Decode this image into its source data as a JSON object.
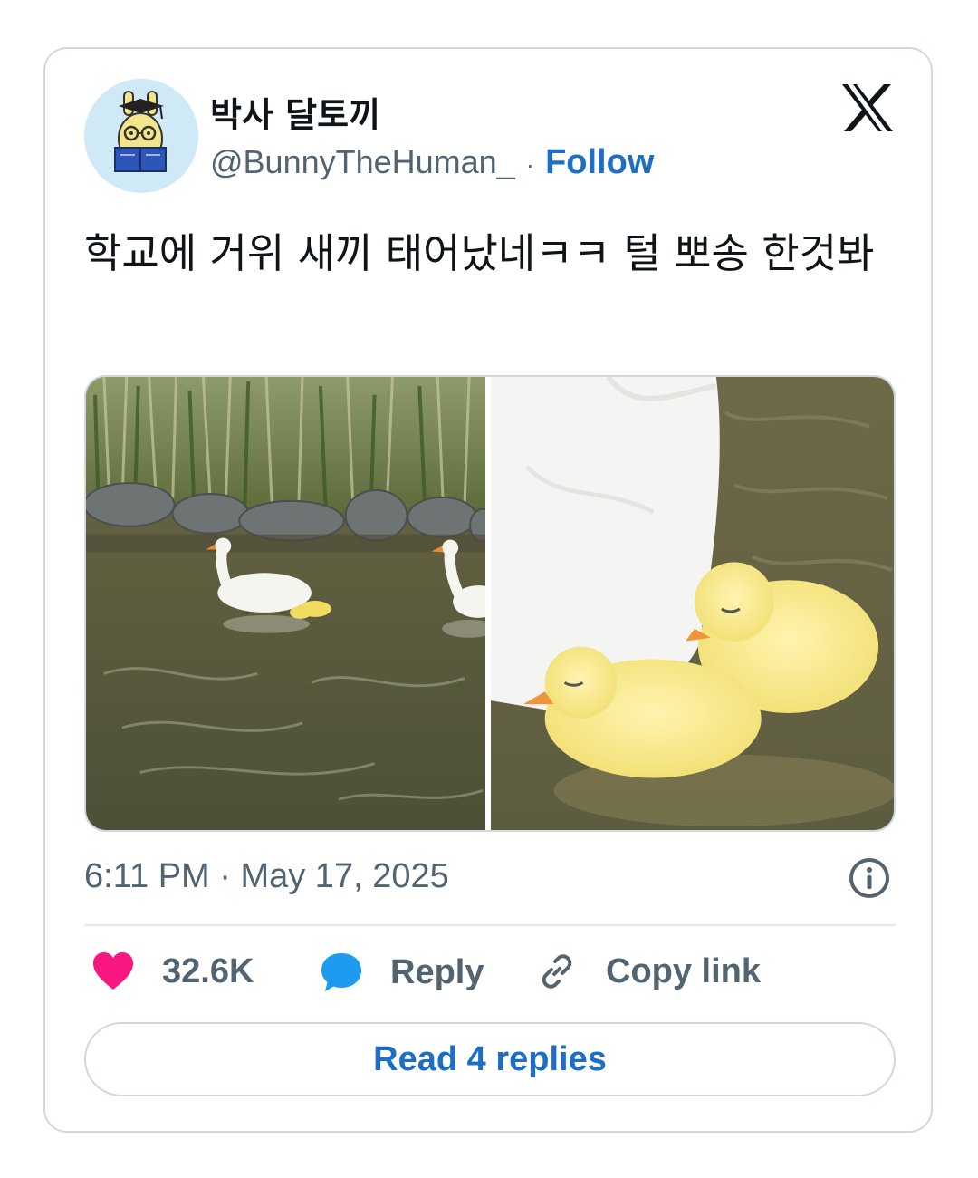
{
  "author": {
    "display_name": "박사 달토끼",
    "handle": "@BunnyTheHuman_",
    "follow_label": "Follow",
    "separator": "·"
  },
  "tweet": {
    "text": "학교에 거위 새끼 태어났네ㅋㅋ 털 뽀송 한것봐",
    "timestamp": "6:11 PM · May 17, 2025"
  },
  "media": [
    {
      "icon": "goose-pond-photo"
    },
    {
      "icon": "goslings-closeup-photo"
    }
  ],
  "actions": {
    "like_count": "32.6K",
    "reply_label": "Reply",
    "copy_label": "Copy link"
  },
  "read_replies_label": "Read 4 replies",
  "colors": {
    "accent": "#1d6fc6",
    "like": "#f91880",
    "reply_icon": "#1d9bf0",
    "muted": "#536471",
    "border": "#cfd9de"
  }
}
